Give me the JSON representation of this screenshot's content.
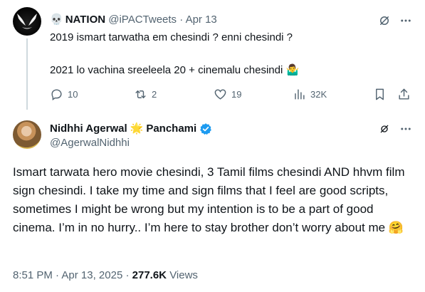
{
  "reply_tweet": {
    "display_name": "NATION",
    "skull_emoji": "💀",
    "handle": "@iPACTweets",
    "separator": "·",
    "date": "Apr 13",
    "line1": "2019 ismart tarwatha em chesindi ? enni chesindi ?",
    "line2": "2021 lo vachina sreeleela 20 + cinemalu chesindi",
    "line2_emoji": "🤷‍♂️",
    "stats": {
      "replies": "10",
      "reposts": "2",
      "likes": "19",
      "views": "32K"
    }
  },
  "main_tweet": {
    "display_name_first": "Nidhhi Agerwal",
    "star_emoji": "🌟",
    "display_name_second": "Panchami",
    "handle": "@AgerwalNidhhi",
    "text": "Ismart tarwata hero movie chesindi, 3 Tamil films chesindi AND hhvm film sign chesindi. I take my time and sign films that I feel are good scripts, sometimes I might be wrong but my intention is to be a part of good cinema. I’m in no hurry.. I’m here to stay brother don’t worry about me 🤗",
    "time": "8:51 PM",
    "separator": "·",
    "date": "Apr 13, 2025",
    "views_count": "277.6K",
    "views_label": "Views"
  },
  "colors": {
    "verified_blue": "#1d9bf0",
    "muted": "#536471",
    "thread_line": "#cfd9de"
  }
}
